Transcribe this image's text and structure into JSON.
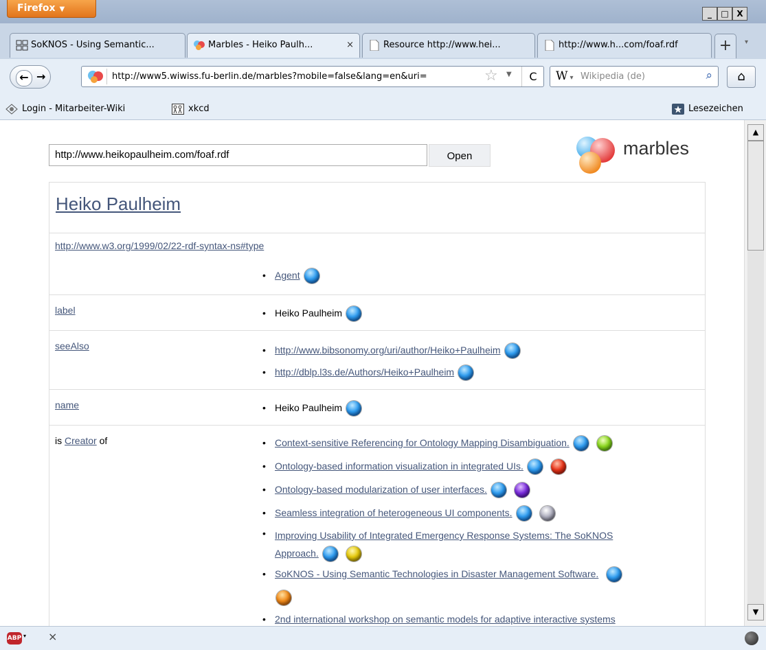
{
  "window": {
    "menu_label": "Firefox",
    "menu_arrow": "▼",
    "minimize": "_",
    "maximize": "□",
    "close": "X"
  },
  "tabs": [
    {
      "title": "SoKNOS - Using Semantic...",
      "active": false
    },
    {
      "title": "Marbles - Heiko Paulh...",
      "active": true,
      "close": "×"
    },
    {
      "title": "Resource http://www.hei...",
      "active": false
    },
    {
      "title": "http://www.h...com/foaf.rdf",
      "active": false
    }
  ],
  "new_tab": "+",
  "tab_list": "▾",
  "navbar": {
    "back": "←",
    "forward": "→",
    "url": "http://www5.wiwiss.fu-berlin.de/marbles?mobile=false&lang=en&uri=",
    "star": "☆",
    "dropdown": "▼",
    "reload": "C",
    "search_engine": "W",
    "search_engine_arrow": "▾",
    "search_placeholder": "Wikipedia (de)",
    "search_go": "⌕",
    "home": "⌂"
  },
  "bookmarks": {
    "items": [
      {
        "label": "Login - Mitarbeiter-Wiki"
      },
      {
        "label": "xkcd"
      }
    ],
    "right_label": "Lesezeichen"
  },
  "page": {
    "uri_value": "http://www.heikopaulheim.com/foaf.rdf",
    "open_label": "Open",
    "logo_text": "marbles",
    "resource_title": "Heiko Paulheim",
    "rows": {
      "type": {
        "predicate": "http://www.w3.org/1999/02/22-rdf-syntax-ns#type",
        "values": [
          "Agent"
        ]
      },
      "label": {
        "predicate": "label",
        "values": [
          "Heiko Paulheim"
        ]
      },
      "seeAlso": {
        "predicate": "seeAlso",
        "values": [
          "http://www.bibsonomy.org/uri/author/Heiko+Paulheim",
          "http://dblp.l3s.de/Authors/Heiko+Paulheim"
        ]
      },
      "name": {
        "predicate": "name",
        "values": [
          "Heiko Paulheim"
        ]
      },
      "creator": {
        "prefix": "is",
        "predicate": "Creator",
        "suffix": "of",
        "values": [
          "Context-sensitive Referencing for Ontology Mapping Disambiguation.",
          "Ontology-based information visualization in integrated UIs.",
          "Ontology-based modularization of user interfaces.",
          "Seamless integration of heterogeneous UI components.",
          "Improving Usability of Integrated Emergency Response Systems: The SoKNOS",
          "Approach.",
          "SoKNOS - Using Semantic Technologies in Disaster Management Software.",
          "2nd international workshop on semantic models for adaptive interactive systems"
        ]
      }
    }
  },
  "status": {
    "abp": "ABP",
    "abp_arrow": "▾",
    "close": "×"
  },
  "scrollbar": {
    "up": "▲",
    "down": "▼"
  },
  "colors": {
    "link": "#44567a",
    "firefox_orange": "#e2741b",
    "chrome_blue": "#c9d6e6"
  }
}
